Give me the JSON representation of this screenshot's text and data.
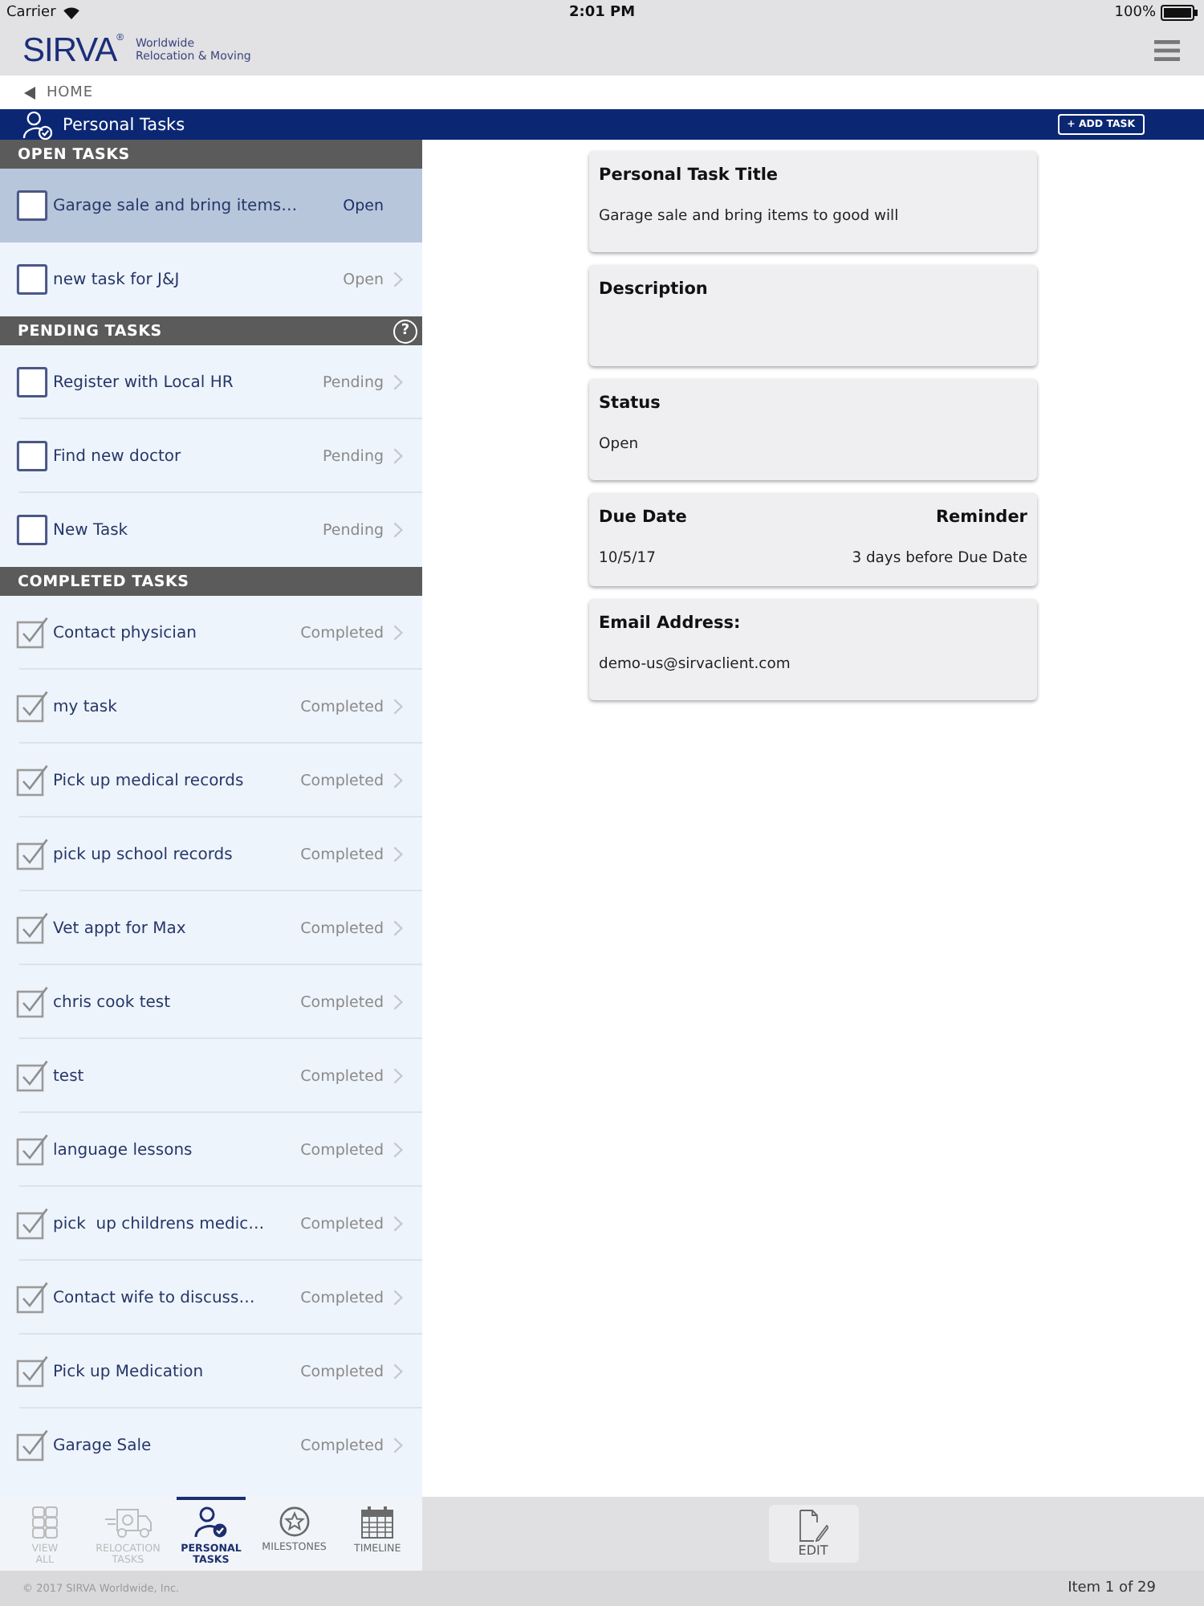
{
  "status_bar": {
    "carrier": "Carrier",
    "time": "2:01 PM",
    "battery": "100%"
  },
  "header": {
    "logo": "SIRVA$^{®}$",
    "tagline": [
      "Worldwide",
      "Relocation & Moving"
    ]
  },
  "breadcrumb": {
    "label": "HOME"
  },
  "title_bar": {
    "title": "Personal Tasks",
    "button": "+ ADD TASK"
  },
  "sections": [
    {
      "title": "OPEN TASKS",
      "tasks": [
        {
          "title": "Garage sale and bring items…",
          "status": "Open",
          "checked": false,
          "selected": true
        },
        {
          "title": "new task for J&J",
          "status": "Open",
          "checked": false,
          "selected": false
        }
      ]
    },
    {
      "title": "PENDING TASKS",
      "help": "?",
      "tasks": [
        {
          "title": "Register with Local HR",
          "status": "Pending",
          "checked": false,
          "selected": false
        },
        {
          "title": "Find new doctor",
          "status": "Pending",
          "checked": false,
          "selected": false
        },
        {
          "title": "New Task",
          "status": "Pending",
          "checked": false,
          "selected": false
        }
      ]
    },
    {
      "title": "COMPLETED TASKS",
      "tasks": [
        {
          "title": "Contact physician",
          "status": "Completed",
          "checked": true,
          "selected": false
        },
        {
          "title": "my task",
          "status": "Completed",
          "checked": true,
          "selected": false
        },
        {
          "title": "Pick up medical records",
          "status": "Completed",
          "checked": true,
          "selected": false
        },
        {
          "title": "pick up school records",
          "status": "Completed",
          "checked": true,
          "selected": false
        },
        {
          "title": "Vet appt for Max",
          "status": "Completed",
          "checked": true,
          "selected": false
        },
        {
          "title": "chris cook test",
          "status": "Completed",
          "checked": true,
          "selected": false
        },
        {
          "title": "test",
          "status": "Completed",
          "checked": true,
          "selected": false
        },
        {
          "title": "language lessons",
          "status": "Completed",
          "checked": true,
          "selected": false
        },
        {
          "title": "pick  up childrens medic…",
          "status": "Completed",
          "checked": true,
          "selected": false
        },
        {
          "title": "Contact wife to discuss…",
          "status": "Completed",
          "checked": true,
          "selected": false
        },
        {
          "title": "Pick up Medication",
          "status": "Completed",
          "checked": true,
          "selected": false
        },
        {
          "title": "Garage Sale",
          "status": "Completed",
          "checked": true,
          "selected": false
        }
      ]
    }
  ],
  "detail_cards": [
    {
      "kind": "single",
      "label": "Personal Task Title",
      "value": "Garage sale and bring items to good will"
    },
    {
      "kind": "single",
      "label": "Description"
    },
    {
      "kind": "single",
      "label": "Status",
      "value": "Open"
    },
    {
      "kind": "split",
      "label": "Due Date",
      "value": "10/5/17",
      "aside_label": "Reminder",
      "aside_value": "3 days before Due Date"
    },
    {
      "kind": "single",
      "label": "Email Address:",
      "value": "demo-us@sirvaclient.com"
    }
  ],
  "bottom_tabs": [
    {
      "label": "VIEW\nALL",
      "selected": false,
      "disabled": true
    },
    {
      "label": "RELOCATION\nTASKS",
      "selected": false,
      "disabled": true
    },
    {
      "label": "PERSONAL\nTASKS",
      "selected": true,
      "disabled": false
    },
    {
      "label": "MILESTONES",
      "selected": false,
      "disabled": false
    },
    {
      "label": "TIMELINE",
      "selected": false,
      "disabled": false
    }
  ],
  "toolbar": {
    "button": "EDIT"
  },
  "footer": {
    "copyright": "© 2017 SIRVA Worldwide, Inc.",
    "pager": "Item 1 of 29"
  }
}
